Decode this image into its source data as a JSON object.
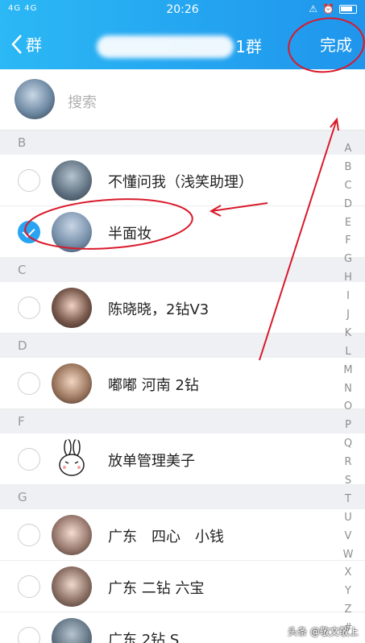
{
  "status_bar": {
    "signal": "4G 4G",
    "time": "20:26",
    "icons": [
      "alarm-icon",
      "clock-icon",
      "battery-icon"
    ]
  },
  "nav": {
    "back_label": "群",
    "title": "1群",
    "done_label": "完成"
  },
  "search": {
    "placeholder": "搜索"
  },
  "sections": [
    {
      "letter": "B",
      "members": [
        {
          "name": "不懂问我（浅笑助理）",
          "checked": false
        },
        {
          "name": "半面妆",
          "checked": true
        }
      ]
    },
    {
      "letter": "C",
      "members": [
        {
          "name": "陈晓晓，2钻V3",
          "checked": false
        }
      ]
    },
    {
      "letter": "D",
      "members": [
        {
          "name": "嘟嘟 河南 2钻",
          "checked": false
        }
      ]
    },
    {
      "letter": "F",
      "members": [
        {
          "name": "放单管理美子",
          "checked": false
        }
      ]
    },
    {
      "letter": "G",
      "members": [
        {
          "name": "广东　四心　小钱",
          "checked": false
        },
        {
          "name": "广东 二钻 六宝",
          "checked": false
        },
        {
          "name": "广东 2钻 S",
          "checked": false
        }
      ]
    }
  ],
  "index_letters": [
    "A",
    "B",
    "C",
    "D",
    "E",
    "F",
    "G",
    "H",
    "I",
    "J",
    "K",
    "L",
    "M",
    "N",
    "O",
    "P",
    "Q",
    "R",
    "S",
    "T",
    "U",
    "V",
    "W",
    "X",
    "Y",
    "Z",
    "#"
  ],
  "watermark": "头条 @敬文敬上",
  "colors": {
    "header_blue": "#1f95ec",
    "check_blue": "#28a4f2",
    "annotation_red": "#d9192a"
  }
}
